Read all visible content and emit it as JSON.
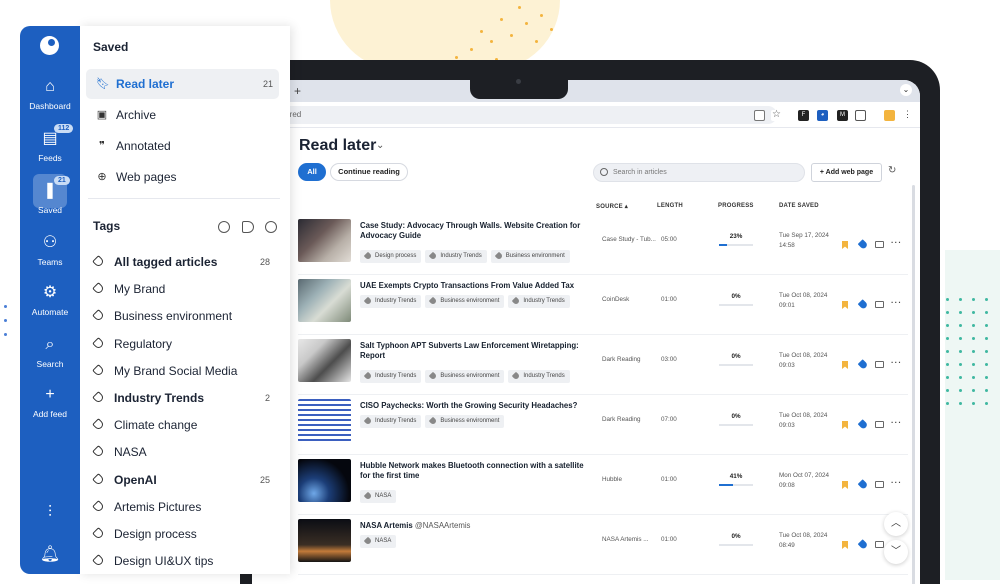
{
  "nav": {
    "items": [
      {
        "label": "Dashboard",
        "icon": "home-icon"
      },
      {
        "label": "Feeds",
        "icon": "feeds-icon",
        "badge": "112"
      },
      {
        "label": "Saved",
        "icon": "bookmark-icon",
        "badge": "21",
        "active": true
      },
      {
        "label": "Teams",
        "icon": "teams-icon"
      },
      {
        "label": "Automate",
        "icon": "automate-icon"
      },
      {
        "label": "Search",
        "icon": "search-icon"
      },
      {
        "label": "Add feed",
        "icon": "plus-icon"
      }
    ]
  },
  "panel": {
    "title": "Saved",
    "items": [
      {
        "label": "Read later",
        "count": "21",
        "icon": "bookmark-icon"
      },
      {
        "label": "Archive",
        "icon": "archive-icon"
      },
      {
        "label": "Annotated",
        "icon": "quote-icon"
      },
      {
        "label": "Web pages",
        "icon": "globe-icon"
      }
    ],
    "tags_title": "Tags",
    "tags": [
      {
        "label": "All tagged articles",
        "count": "28",
        "bold": true
      },
      {
        "label": "My Brand"
      },
      {
        "label": "Business environment"
      },
      {
        "label": "Regulatory"
      },
      {
        "label": "My Brand Social Media"
      },
      {
        "label": "Industry Trends",
        "count": "2",
        "bold": true
      },
      {
        "label": "Climate change"
      },
      {
        "label": "NASA"
      },
      {
        "label": "OpenAI",
        "count": "25",
        "bold": true
      },
      {
        "label": "Artemis Pictures"
      },
      {
        "label": "Design process"
      },
      {
        "label": "Design UI&UX tips"
      }
    ]
  },
  "browser": {
    "url_fragment": "rred",
    "tab_plus": "+"
  },
  "main": {
    "title": "Read later",
    "filters": [
      "All",
      "Continue reading"
    ],
    "search_placeholder": "Search in articles",
    "add_button": "+ Add web page",
    "columns": {
      "source": "SOURCE",
      "length": "LENGTH",
      "progress": "PROGRESS",
      "date": "DATE SAVED"
    },
    "articles": [
      {
        "title": "Case Study: Advocacy Through Walls. Website Creation for Advocacy Guide",
        "tags": [
          "Design process",
          "Industry Trends",
          "Business environment"
        ],
        "source": "Case Study - Tub...",
        "length": "05:00",
        "progress": "23%",
        "progress_value": 0.23,
        "date": "Tue Sep 17, 2024",
        "time": "14:58"
      },
      {
        "title": "UAE Exempts Crypto Transactions From Value Added Tax",
        "tags": [
          "Industry Trends",
          "Business environment",
          "Industry Trends"
        ],
        "source": "CoinDesk",
        "length": "01:00",
        "progress": "0%",
        "progress_value": 0,
        "date": "Tue Oct 08, 2024",
        "time": "09:01"
      },
      {
        "title": "Salt Typhoon APT Subverts Law Enforcement Wiretapping: Report",
        "tags": [
          "Industry Trends",
          "Business environment",
          "Industry Trends"
        ],
        "source": "Dark Reading",
        "length": "03:00",
        "progress": "0%",
        "progress_value": 0,
        "date": "Tue Oct 08, 2024",
        "time": "09:03"
      },
      {
        "title": "CISO Paychecks: Worth the Growing Security Headaches?",
        "tags": [
          "Industry Trends",
          "Business environment"
        ],
        "source": "Dark Reading",
        "length": "07:00",
        "progress": "0%",
        "progress_value": 0,
        "date": "Tue Oct 08, 2024",
        "time": "09:03"
      },
      {
        "title": "Hubble Network makes Bluetooth connection with a satellite for the first time",
        "tags": [
          "NASA"
        ],
        "source": "Hubble",
        "length": "01:00",
        "progress": "41%",
        "progress_value": 0.41,
        "date": "Mon Oct 07, 2024",
        "time": "09:08"
      },
      {
        "title": "NASA Artemis",
        "handle": "@NASAArtemis",
        "tags": [
          "NASA"
        ],
        "source": "NASA Artemis ...",
        "length": "01:00",
        "progress": "0%",
        "progress_value": 0,
        "date": "Tue Oct 08, 2024",
        "time": "08:49"
      }
    ]
  },
  "colors": {
    "accent": "#1f6fd1",
    "rail": "#1d5fc0",
    "bookmark": "#f3b43e"
  }
}
